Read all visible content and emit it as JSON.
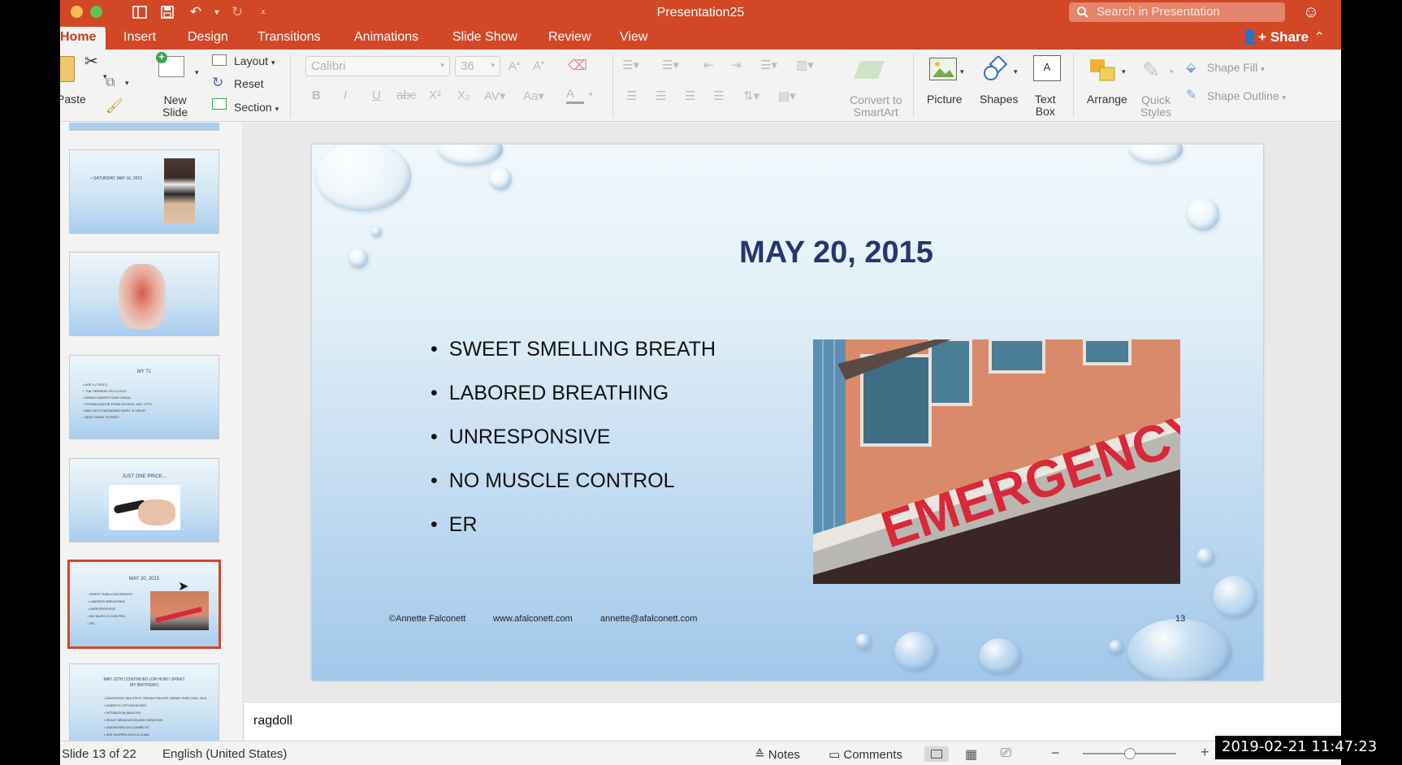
{
  "window": {
    "title": "Presentation25"
  },
  "search": {
    "placeholder": "Search in Presentation"
  },
  "tabs": [
    "Home",
    "Insert",
    "Design",
    "Transitions",
    "Animations",
    "Slide Show",
    "Review",
    "View"
  ],
  "share_label": "Share",
  "ribbon": {
    "paste": "Paste",
    "new_slide": "New\nSlide",
    "layout": "Layout",
    "reset": "Reset",
    "section": "Section",
    "font_name": "Calibri",
    "font_size": "36",
    "convert_smartart": "Convert to\nSmartArt",
    "picture": "Picture",
    "shapes": "Shapes",
    "text_box": "Text\nBox",
    "arrange": "Arrange",
    "quick_styles": "Quick\nStyles",
    "shape_fill": "Shape Fill",
    "shape_outline": "Shape Outline"
  },
  "thumbnails": [
    {
      "title": "",
      "lines": []
    },
    {
      "title": "• SATURDAY, MAY 16, 2015",
      "lines": []
    },
    {
      "title": "",
      "lines": []
    },
    {
      "title": "MY T1",
      "lines": [
        "• AGE 4 (7/2017)",
        "• \"SALTIER/BOR OR A COLD\"",
        "• DRINKS WATER THAN USUAL",
        "• STOMACHACHE FROM SCHOOL MAY 17TH",
        "• MAY 18TH DIAGNOSED WITH \"A VIRUS\"",
        "• SENT HOME TO REST"
      ]
    },
    {
      "title": "JUST ONE PRICK...",
      "lines": []
    },
    {
      "title": "MAY 20, 2015",
      "lines": [
        "• SWEET SMELLING BREATH",
        "• LABORED BREATHING",
        "• UNRESPONSIVE",
        "• NO MUSCLE CONTROL",
        "• ER"
      ]
    },
    {
      "title": "MAY 20TH CONTINUED (OR HOW I SPENT MY BIRTHDAY)",
      "lines": [
        "• DIAGNOSIS: MULTIPLE ORGAN FAILURE, BRAIN SWELLING, DKA",
        "• DIABETIC KETOACIDOSIS",
        "• INTUBATION (MOUTH)",
        "• HEAVY MEDICATION AND SEDATION",
        "• DIAGNOSED AS A DIABETIC",
        "• SHE SLIPPED INTO A COMA"
      ]
    }
  ],
  "slide": {
    "title": "MAY 20, 2015",
    "bullets": [
      "SWEET SMELLING BREATH",
      "LABORED BREATHING",
      "UNRESPONSIVE",
      "NO MUSCLE CONTROL",
      "ER"
    ],
    "photo_sign": "EMERGENCY",
    "footer": {
      "copyright": "©Annette Falconett",
      "website": "www.afalconett.com",
      "email": "annette@afalconett.com",
      "page_number": "13"
    }
  },
  "notes": "ragdoll",
  "status": {
    "slide_count": "Slide 13 of 22",
    "language": "English (United States)",
    "notes": "Notes",
    "comments": "Comments"
  },
  "timestamp": "2019-02-21 11:47:23",
  "colors": {
    "accent": "#d24726",
    "slide_title": "#26366e"
  }
}
